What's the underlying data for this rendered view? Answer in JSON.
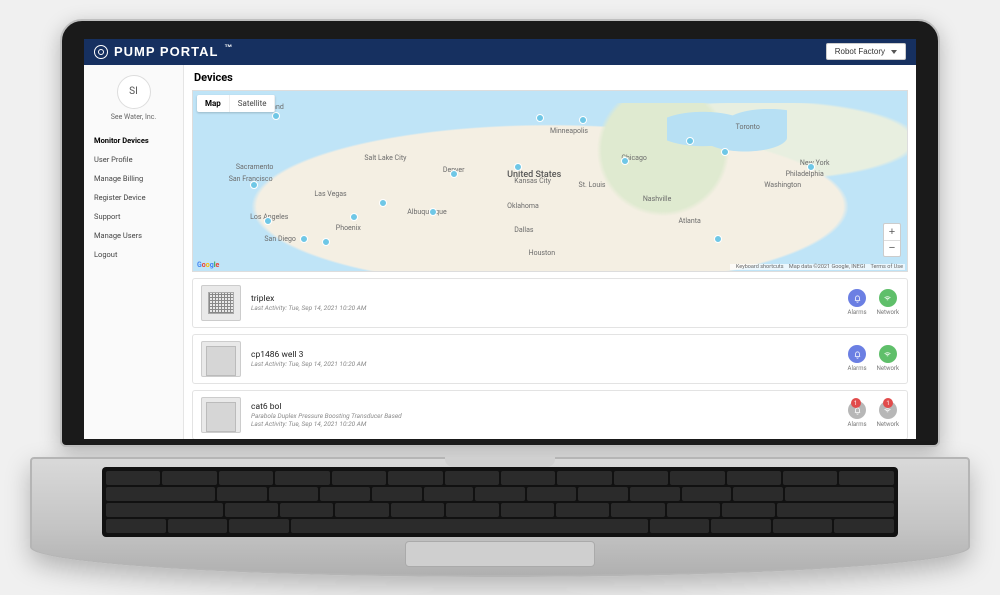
{
  "header": {
    "brand": "PUMP PORTAL",
    "factory_select": "Robot Factory"
  },
  "sidebar": {
    "avatar_initials": "SI",
    "org_name": "See Water, Inc.",
    "items": [
      {
        "label": "Monitor Devices",
        "active": true
      },
      {
        "label": "User Profile"
      },
      {
        "label": "Manage Billing"
      },
      {
        "label": "Register Device"
      },
      {
        "label": "Support"
      },
      {
        "label": "Manage Users"
      },
      {
        "label": "Logout"
      }
    ]
  },
  "page": {
    "title": "Devices"
  },
  "map": {
    "tabs": {
      "map": "Map",
      "satellite": "Satellite"
    },
    "country_label": "United States",
    "city_labels": [
      "Portland",
      "Salt Lake City",
      "Denver",
      "Las Vegas",
      "San Francisco",
      "Los Angeles",
      "San Diego",
      "Phoenix",
      "Albuquerque",
      "Dallas",
      "Houston",
      "Kansas City",
      "St. Louis",
      "Chicago",
      "Nashville",
      "Atlanta",
      "Toronto",
      "New York",
      "Philadelphia",
      "Washington",
      "Sacramento",
      "Minneapolis",
      "Oklahoma"
    ],
    "zoom": {
      "in": "+",
      "out": "−"
    },
    "attribution": {
      "shortcuts": "Keyboard shortcuts",
      "data": "Map data ©2021 Google, INEGI",
      "terms": "Terms of Use"
    }
  },
  "devices": [
    {
      "title": "triplex",
      "subtitle": "",
      "last_activity": "Last Activity: Tue, Sep 14, 2021 10:20 AM",
      "alarms_label": "Alarms",
      "network_label": "Network",
      "alarms_color": "blue",
      "network_color": "green",
      "alarm_count": 0,
      "network_count": 0
    },
    {
      "title": "cp1486 well 3",
      "subtitle": "",
      "last_activity": "Last Activity: Tue, Sep 14, 2021 10:20 AM",
      "alarms_label": "Alarms",
      "network_label": "Network",
      "alarms_color": "blue",
      "network_color": "green",
      "alarm_count": 0,
      "network_count": 0
    },
    {
      "title": "cat6 bol",
      "subtitle": "Parabola Duplex Pressure Boosting Transducer Based",
      "last_activity": "Last Activity: Tue, Sep 14, 2021 10:20 AM",
      "alarms_label": "Alarms",
      "network_label": "Network",
      "alarms_color": "grey",
      "network_color": "grey",
      "alarm_count": 1,
      "network_count": 1
    }
  ]
}
